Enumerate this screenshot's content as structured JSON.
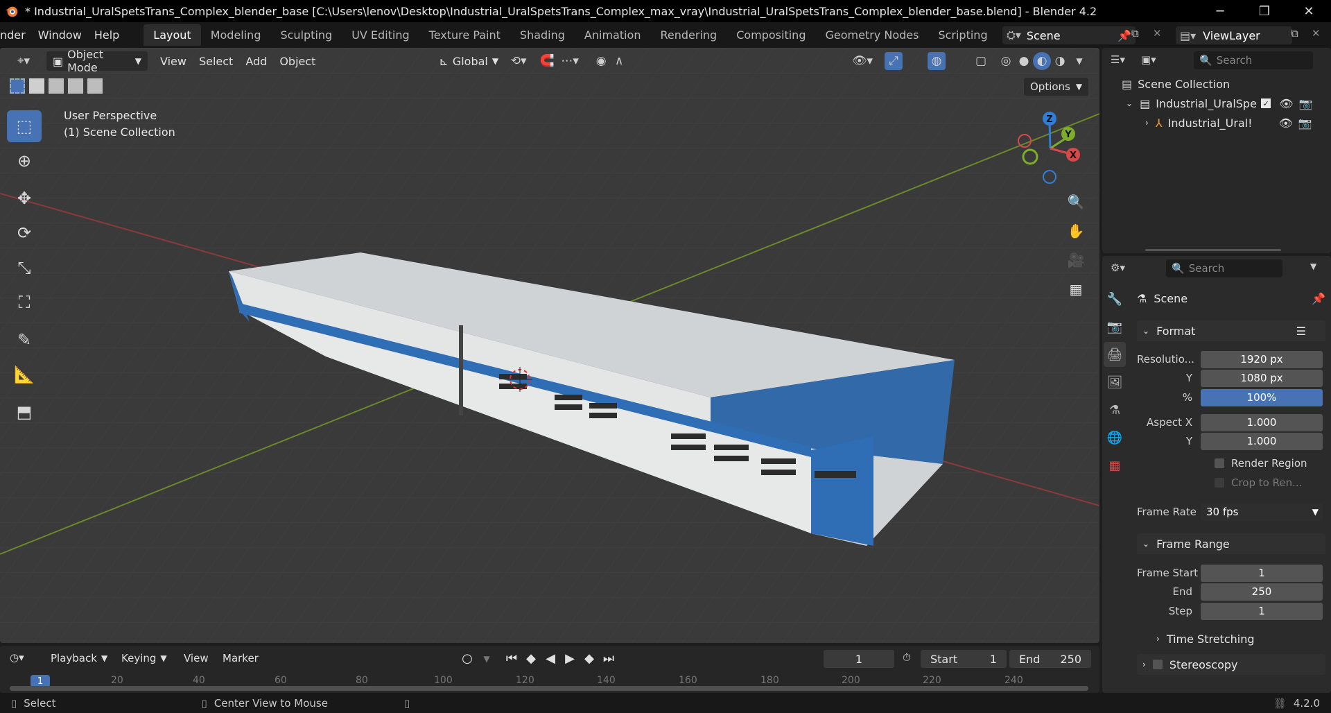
{
  "titlebar": {
    "title": "* Industrial_UralSpetsTrans_Complex_blender_base [C:\\Users\\lenov\\Desktop\\Industrial_UralSpetsTrans_Complex_max_vray\\Industrial_UralSpetsTrans_Complex_blender_base.blend] - Blender 4.2"
  },
  "topbar": {
    "menus": [
      "nder",
      "Window",
      "Help"
    ],
    "workspaces": [
      "Layout",
      "Modeling",
      "Sculpting",
      "UV Editing",
      "Texture Paint",
      "Shading",
      "Animation",
      "Rendering",
      "Compositing",
      "Geometry Nodes",
      "Scripting"
    ],
    "active_workspace": "Layout",
    "scene_name": "Scene",
    "view_layer": "ViewLayer"
  },
  "viewport": {
    "mode": "Object Mode",
    "menus": [
      "View",
      "Select",
      "Add",
      "Object"
    ],
    "transform_orientation": "Global",
    "options_label": "Options",
    "overlay_line1": "User Perspective",
    "overlay_line2": "(1) Scene Collection",
    "gizmo_axes": {
      "z": "Z",
      "y": "Y",
      "x": "X"
    }
  },
  "outliner": {
    "search_placeholder": "Search",
    "root": "Scene Collection",
    "collection": "Industrial_UralSpet",
    "object": "Industrial_Ural!"
  },
  "properties": {
    "search_placeholder": "Search",
    "context": "Scene",
    "format_panel": "Format",
    "resolution_x_label": "Resolutio...",
    "resolution_x": "1920 px",
    "resolution_y_label": "Y",
    "resolution_y": "1080 px",
    "percent_label": "%",
    "percent": "100%",
    "aspect_x_label": "Aspect X",
    "aspect_x": "1.000",
    "aspect_y_label": "Y",
    "aspect_y": "1.000",
    "render_region": "Render Region",
    "crop": "Crop to Ren...",
    "frame_rate_label": "Frame Rate",
    "frame_rate": "30 fps",
    "frame_range_panel": "Frame Range",
    "frame_start_label": "Frame Start",
    "frame_start": "1",
    "end_label": "End",
    "end": "250",
    "step_label": "Step",
    "step": "1",
    "time_stretching": "Time Stretching",
    "stereoscopy": "Stereoscopy"
  },
  "timeline": {
    "menus": [
      "Playback",
      "Keying",
      "View",
      "Marker"
    ],
    "current_frame": "1",
    "start_label": "Start",
    "start": "1",
    "end_label": "End",
    "end": "250",
    "ticks": [
      "1",
      "20",
      "40",
      "60",
      "80",
      "100",
      "120",
      "140",
      "160",
      "180",
      "200",
      "220",
      "240"
    ]
  },
  "statusbar": {
    "select": "Select",
    "center_view": "Center View to Mouse",
    "version": "4.2.0"
  }
}
